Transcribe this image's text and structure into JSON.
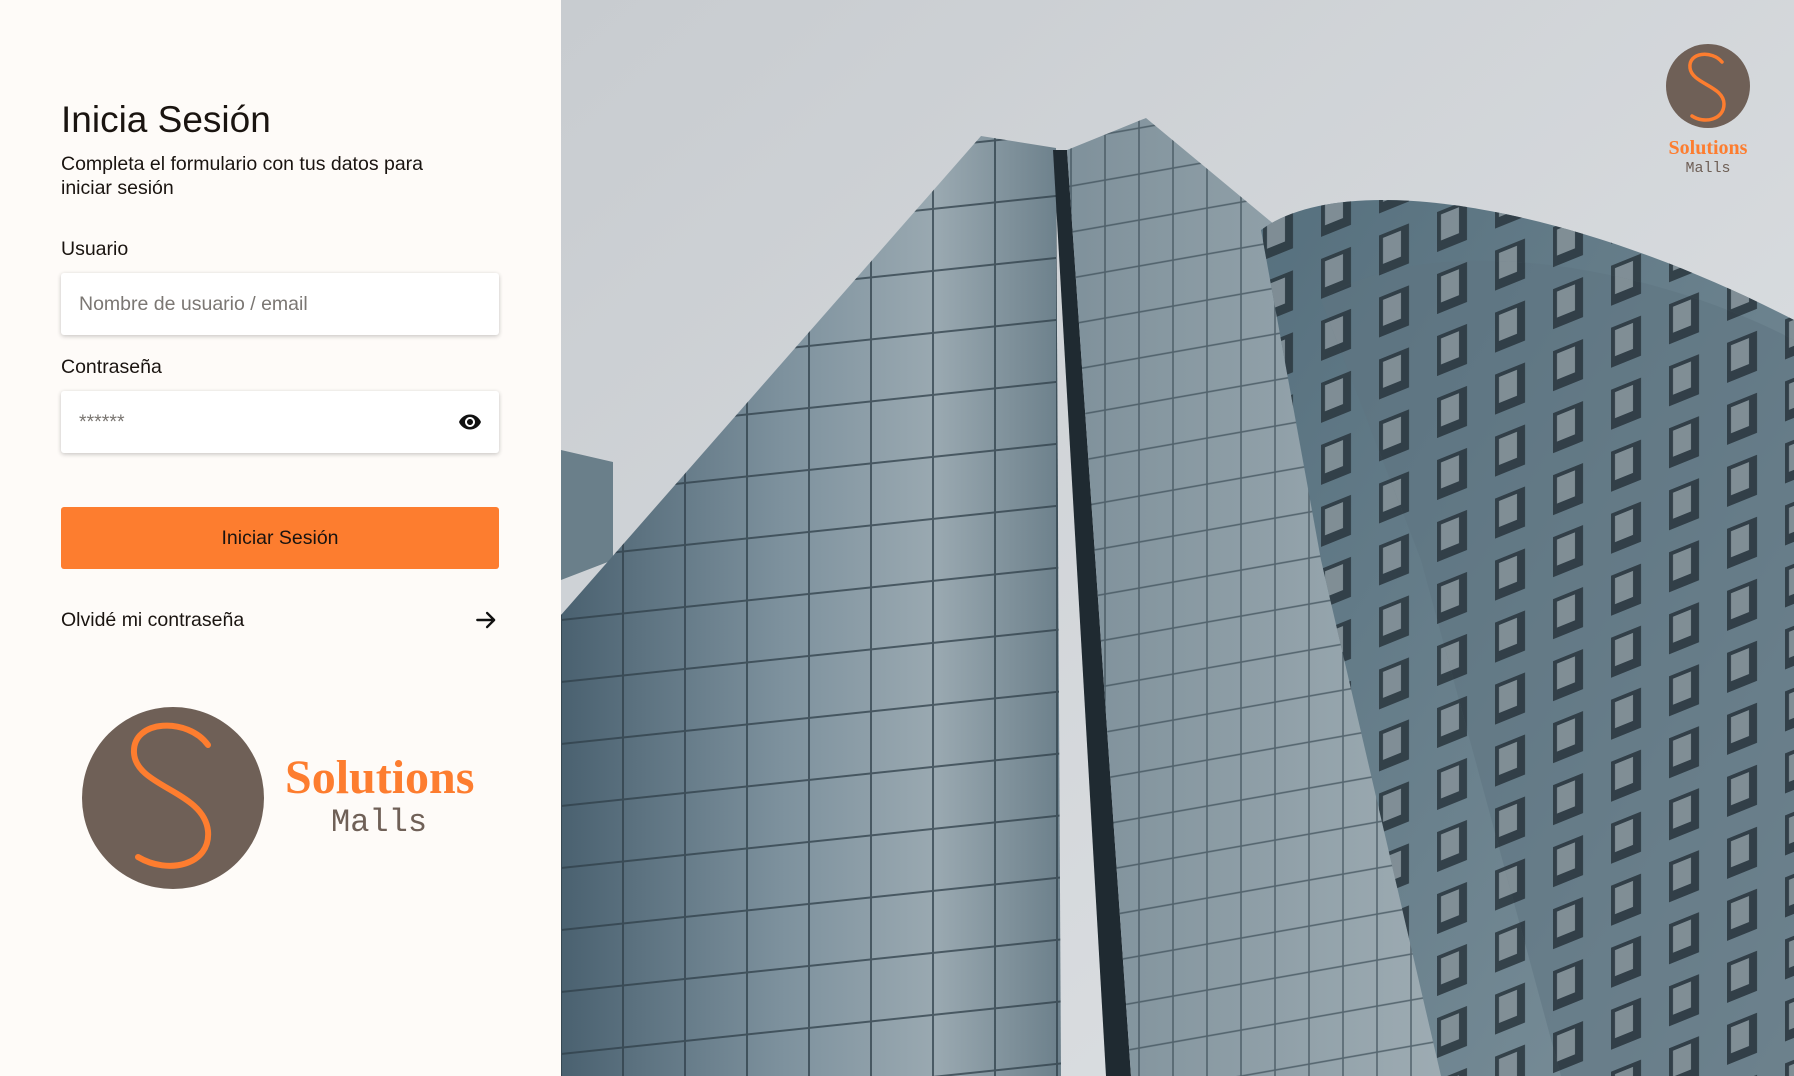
{
  "login": {
    "title": "Inicia Sesión",
    "subtitle": "Completa el formulario con tus datos para\n iniciar sesión",
    "username_label": "Usuario",
    "username_placeholder": "Nombre de usuario / email",
    "password_label": "Contraseña",
    "password_placeholder": "******",
    "submit_label": "Iniciar Sesión",
    "forgot_label": "Olvidé mi contraseña"
  },
  "brand": {
    "name_line1": "Solutions",
    "name_line2": "Malls",
    "letter": "S"
  },
  "icons": {
    "password_toggle": "eye-icon",
    "forgot_link": "arrow-right-icon"
  },
  "colors": {
    "accent": "#fd7d2f",
    "logo_circle": "#6f6057",
    "panel_background": "#fefbf8"
  }
}
